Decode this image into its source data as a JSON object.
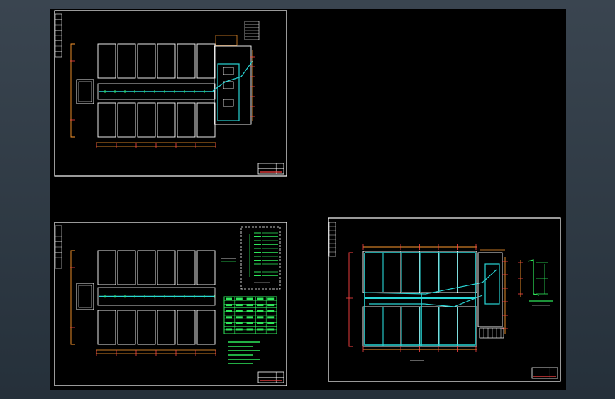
{
  "app": {
    "view": "CAD model space",
    "background_color": "#000000",
    "frame_color": "#2f3943"
  },
  "colors": {
    "sheet_border": "#ffffff",
    "rooms": "#ffffff",
    "dimensions_red": "#ff4444",
    "dimensions_orange": "#ff9a2e",
    "piping_cyan": "#29d6d6",
    "annotation_green": "#2ee85a",
    "highlight_yellow": "#f0e040"
  },
  "sheets": [
    {
      "id": "sheet-1",
      "kind": "plan-with-section",
      "icon": "floor-plan-icon"
    },
    {
      "id": "sheet-2",
      "kind": "plan-with-legend-and-table",
      "icon": "floor-plan-icon"
    },
    {
      "id": "sheet-3",
      "kind": "piping-plan-with-riser",
      "icon": "floor-plan-icon"
    }
  ],
  "legend": {
    "rows": 12
  },
  "equipment_table": {
    "rows": 10,
    "columns": 5
  },
  "notes": {
    "lines": 6
  }
}
